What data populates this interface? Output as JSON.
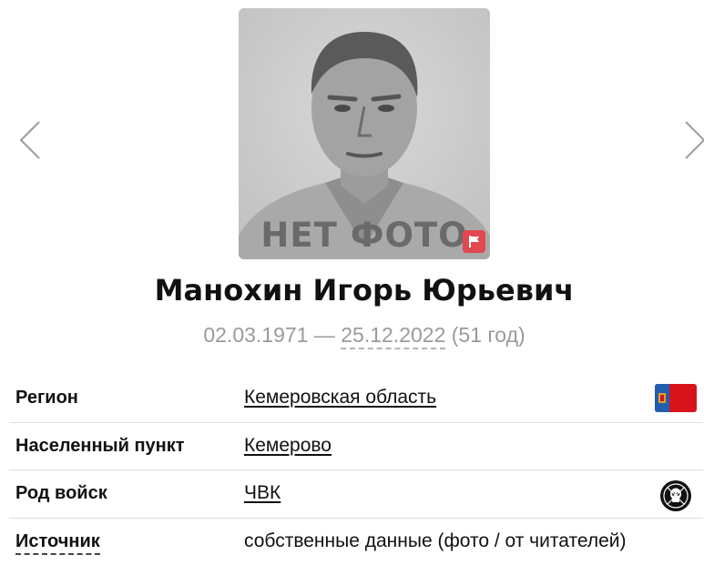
{
  "photo": {
    "caption": "НЕТ ФОТО",
    "report_icon": "flag-icon"
  },
  "person": {
    "name": "Манохин Игорь Юрьевич",
    "birth_date": "02.03.1971",
    "separator": " — ",
    "death_date": "25.12.2022",
    "age": "(51 год)"
  },
  "details": [
    {
      "label": "Регион",
      "value": "Кемеровская область",
      "icon": "kemerovo-region-flag"
    },
    {
      "label": "Населенный пункт",
      "value": "Кемерово"
    },
    {
      "label": "Род войск",
      "value": "ЧВК",
      "icon": "pmc-skull-icon"
    },
    {
      "label": "Источник",
      "value": "собственные данные (фото / от читателей)"
    }
  ],
  "colors": {
    "flag_red": "#e2484f",
    "region_flag_red": "#d8141b",
    "region_flag_blue": "#1f5fae",
    "muted_text": "#9a9a9a"
  }
}
